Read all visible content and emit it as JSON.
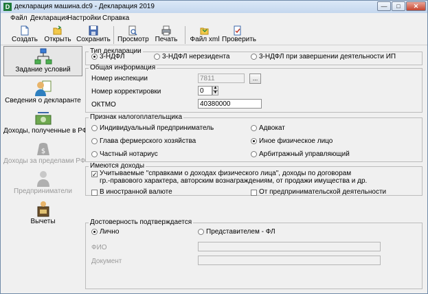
{
  "window": {
    "title": "декларация машина.dc9 - Декларация 2019",
    "app_icon_letter": "D",
    "minimize_glyph": "—",
    "maximize_glyph": "□",
    "close_glyph": "✕"
  },
  "menu": [
    "Файл",
    "Декларация",
    "Настройки",
    "Справка"
  ],
  "toolbar": {
    "create": "Создать",
    "open": "Открыть",
    "save": "Сохранить",
    "preview": "Просмотр",
    "print": "Печать",
    "xml": "Файл xml",
    "check": "Проверить"
  },
  "sidebar": {
    "items": [
      {
        "label": "Задание условий",
        "icon": "conditions-icon",
        "active": true,
        "disabled": false
      },
      {
        "label": "Сведения о декларанте",
        "icon": "declarant-icon",
        "active": false,
        "disabled": false
      },
      {
        "label": "Доходы, полученные в РФ",
        "icon": "income-rf-icon",
        "active": false,
        "disabled": false
      },
      {
        "label": "Доходы за пределами РФ",
        "icon": "income-abroad-icon",
        "active": false,
        "disabled": true
      },
      {
        "label": "Предприниматели",
        "icon": "entrepreneurs-icon",
        "active": false,
        "disabled": true
      },
      {
        "label": "Вычеты",
        "icon": "deductions-icon",
        "active": false,
        "disabled": false
      }
    ]
  },
  "decl_type": {
    "legend": "Тип декларации",
    "options": [
      "3-НДФЛ",
      "3-НДФЛ нерезидента",
      "3-НДФЛ при завершении деятельности ИП"
    ],
    "selected_index": 0
  },
  "general": {
    "legend": "Общая информация",
    "inspection_label": "Номер инспекции",
    "inspection_value": "7811",
    "browse_label": "...",
    "correction_label": "Номер корректировки",
    "correction_value": "0",
    "oktmo_label": "ОКТМО",
    "oktmo_value": "40380000"
  },
  "taxpayer": {
    "legend": "Признак налогоплательщика",
    "options": [
      "Индивидуальный предприниматель",
      "Адвокат",
      "Глава фермерского хозяйства",
      "Иное физическое лицо",
      "Частный нотариус",
      "Арбитражный управляющий"
    ],
    "selected_index": 3
  },
  "income": {
    "legend": "Имеются доходы",
    "certified_line1": "Учитываемые \"справками о доходах физического лица\", доходы по договорам",
    "certified_line2": "гр.-правового характера, авторским вознаграждениям, от продажи имущества и др.",
    "certified_checked": true,
    "foreign_currency": "В иностранной валюте",
    "foreign_checked": false,
    "business": "От предпринимательской деятельности",
    "business_checked": false
  },
  "confirm": {
    "legend": "Достоверность подтверждается",
    "personal": "Лично",
    "representative": "Представителем - ФЛ",
    "selected": "personal",
    "fio_label": "ФИО",
    "fio_value": "",
    "doc_label": "Документ",
    "doc_value": ""
  }
}
